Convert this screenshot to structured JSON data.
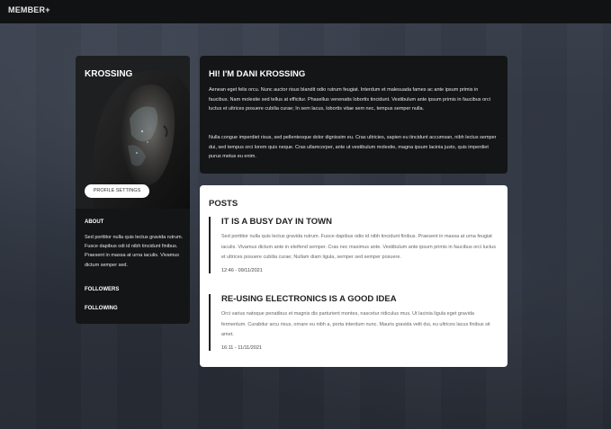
{
  "nav": {
    "brand": "MEMBER+"
  },
  "profile": {
    "name": "KROSSING",
    "settings_button": "PROFILE SETTINGS",
    "about_title": "ABOUT",
    "about_text": "Sed porttitor nulla quis lectus gravida rutrum. Fusce dapibus odi id nibh tincidunt finibus. Praesent in massa at urna iaculis. Vivamus dictum semper sed.",
    "followers_label": "FOLLOWERS",
    "following_label": "FOLLOWING"
  },
  "intro": {
    "title": "HI! I'M DANI KROSSING",
    "paragraphs": [
      "Aenean eget felis orcu. Nunc auctor risus blandit odio rutrum feugiat. Interdum et malesuada fames ac ante ipsum primis in faucibus. Nam molestie sed tellus at efficitur. Phasellus venenatis lobortis tincidunt. Vestibulum ante ipsum primis in faucibus orci luctus et ultrices posuere cubilia curae; In sem lacus, lobortis vitae sem nec, tempus semper nulla.",
      "Nulla congue imperdiet risus, sed pellentesque dolor dignissim eu. Cras ultricies, sapien eu tincidunt accumsan, nibh lectus semper dui, sed tempus orci lorem quis neque. Cras ullamcorper, ante ut vestibulum molestie, magna ipsum lacinia justo, quis imperdiet purus metus eu enim."
    ]
  },
  "posts": {
    "title": "POSTS",
    "items": [
      {
        "title": "IT IS A BUSY DAY IN TOWN",
        "body": "Sed porttitor nulla quis lectus gravida rutrum. Fusce dapibus odio id nibh tincidunt finibus. Praesent in massa at urna feugiat iaculis. Vivamus dictum ante in eleifend semper. Cras nec maximus ante. Vestibulum ante ipsum primis in faucibus orci luctus et ultrices posuere cubilia curae; Nullam diam ligula, semper sed semper posuere.",
        "date": "12:46 - 09/11/2021"
      },
      {
        "title": "RE-USING ELECTRONICS IS A GOOD IDEA",
        "body": "Orci varius natoque penatibus et magnis dis parturient montes, nascetur ridiculus mus. Ut lacinia ligula eget gravida fermentum. Curabitur arcu risus, ornare eu nibh a, porta interdum nunc. Mauris gravida velit dui, eu ultrices lacus finibus sit amet.",
        "date": "16:11 - 11/11/2021"
      }
    ]
  }
}
